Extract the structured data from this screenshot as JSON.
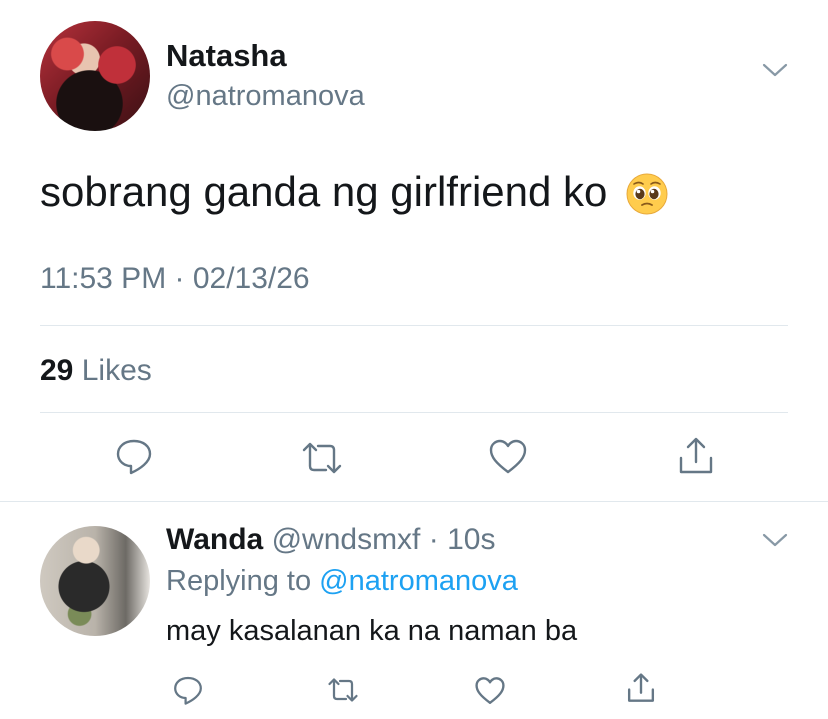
{
  "tweet": {
    "author_name": "Natasha",
    "author_handle": "@natromanova",
    "text": "sobrang ganda ng girlfriend ko",
    "emoji": "pleading-face",
    "timestamp": "11:53 PM · 02/13/26",
    "likes_count": "29",
    "likes_label": "Likes"
  },
  "actions": [
    "reply-icon",
    "retweet-icon",
    "like-icon",
    "share-icon"
  ],
  "reply": {
    "author_name": "Wanda",
    "author_handle": "@wndsmxf",
    "time": "10s",
    "separator": "·",
    "replying_prefix": "Replying to",
    "replying_to": "@natromanova",
    "text": "may kasalanan ka na naman ba"
  },
  "colors": {
    "text": "#14171a",
    "secondary": "#657786",
    "link": "#1da1f2",
    "divider": "#e1e8ed"
  }
}
